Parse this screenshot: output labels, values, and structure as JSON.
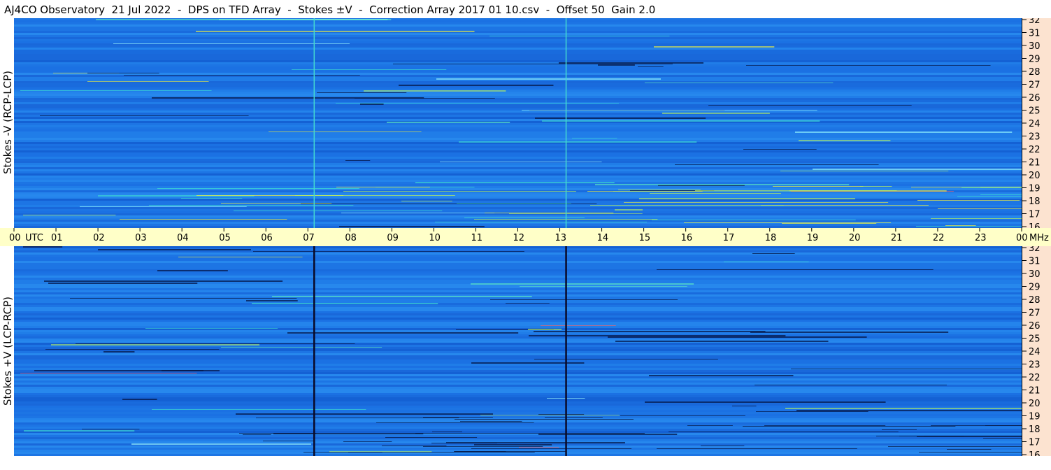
{
  "title": "AJ4CO Observatory  21 Jul 2022  -  DPS on TFD Array  -  Stokes ±V  -  Correction Array 2017 01 10.csv  -  Offset 50  Gain 2.0",
  "chart_data": [
    {
      "type": "heatmap",
      "panel": "top",
      "ylabel": "Stokes -V (RCP-LCP)",
      "x_axis": {
        "unit_label": "UTC",
        "tick_labels": [
          "00",
          "01",
          "02",
          "03",
          "04",
          "05",
          "06",
          "07",
          "08",
          "09",
          "10",
          "11",
          "12",
          "13",
          "14",
          "15",
          "16",
          "17",
          "18",
          "19",
          "20",
          "21",
          "22",
          "23",
          "00"
        ],
        "range_hours": [
          0,
          24
        ]
      },
      "y_axis": {
        "unit_label": "MHz",
        "tick_labels": [
          "16",
          "17",
          "18",
          "19",
          "20",
          "21",
          "22",
          "23",
          "24",
          "25",
          "26",
          "27",
          "28",
          "29",
          "30",
          "31",
          "32"
        ],
        "range_mhz": [
          16,
          32
        ]
      },
      "marker_lines_utc": [
        7.15,
        13.15
      ],
      "marker_color": "#43d9d0"
    },
    {
      "type": "heatmap",
      "panel": "bottom",
      "ylabel": "Stokes +V (LCP-RCP)",
      "x_axis": {
        "tick_labels": [
          "00",
          "01",
          "02",
          "03",
          "04",
          "05",
          "06",
          "07",
          "08",
          "09",
          "10",
          "11",
          "12",
          "13",
          "14",
          "15",
          "16",
          "17",
          "18",
          "19",
          "20",
          "21",
          "22",
          "23",
          "00"
        ],
        "range_hours": [
          0,
          24
        ]
      },
      "y_axis": {
        "tick_labels": [
          "16",
          "17",
          "18",
          "19",
          "20",
          "21",
          "22",
          "23",
          "24",
          "25",
          "26",
          "27",
          "28",
          "29",
          "30",
          "31",
          "32"
        ],
        "range_mhz": [
          16,
          32
        ]
      },
      "marker_lines_utc": [
        7.15,
        13.15
      ],
      "marker_color": "#0a0a28"
    }
  ],
  "colors": {
    "background": "#1e78e6",
    "time_bar": "#ffffc8",
    "freq_scale": "#fce3d0"
  }
}
